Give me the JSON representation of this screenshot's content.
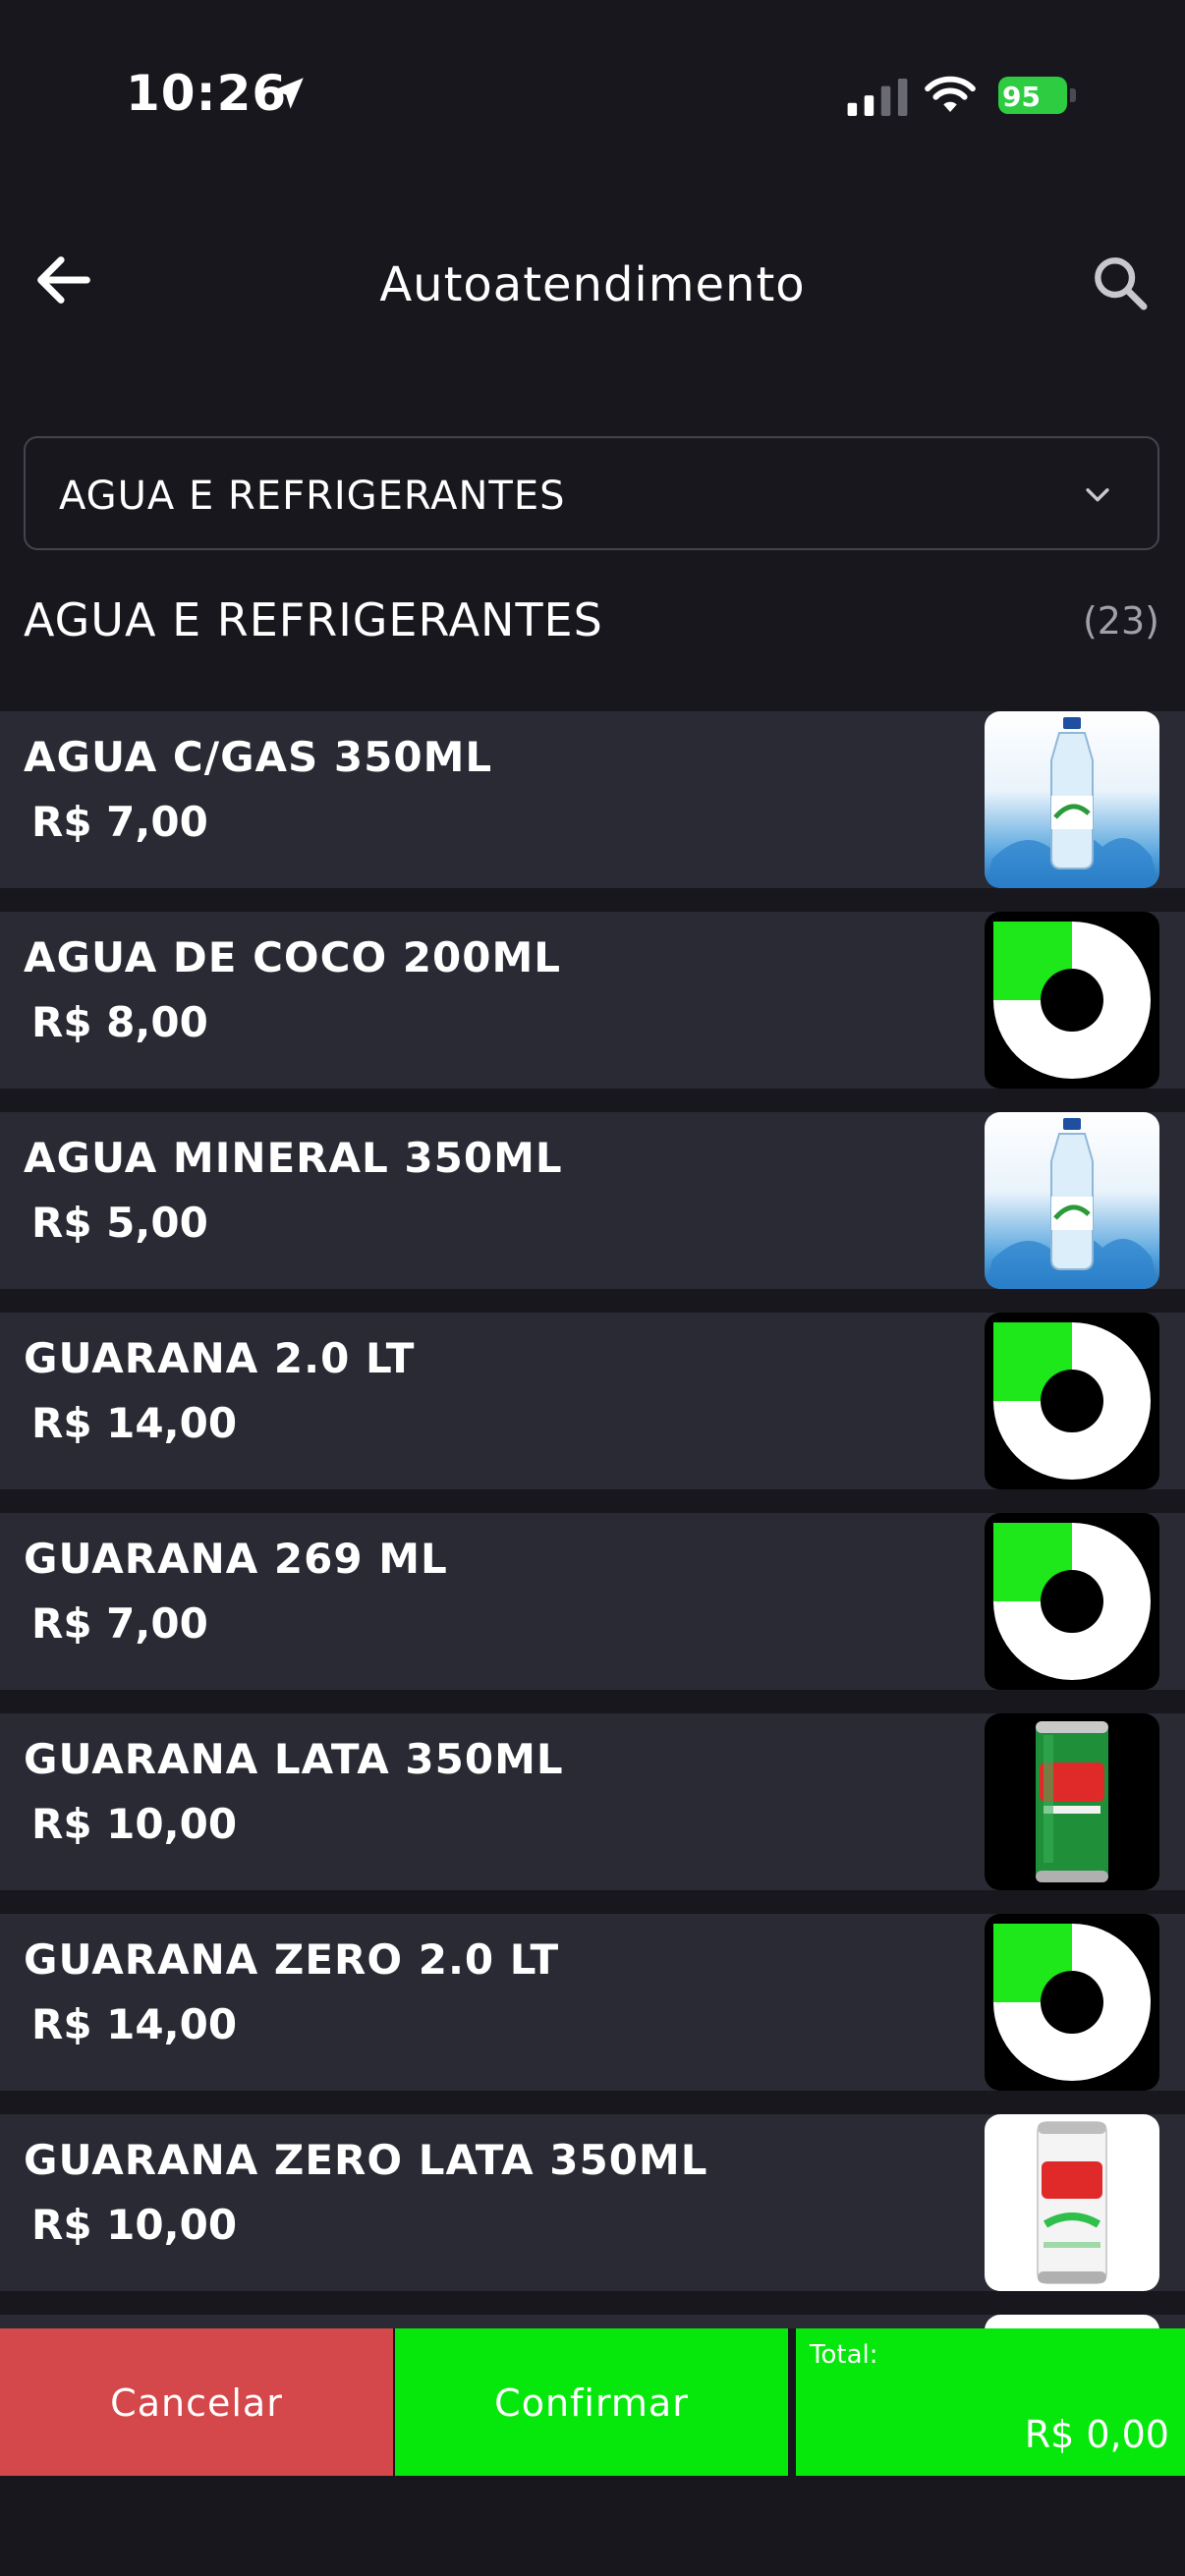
{
  "status_bar": {
    "time": "10:26",
    "battery": "95"
  },
  "header": {
    "title": "Autoatendimento"
  },
  "category_select": {
    "value": "AGUA E REFRIGERANTES"
  },
  "section": {
    "title": "AGUA E REFRIGERANTES",
    "count": "(23)"
  },
  "products": [
    {
      "name": "AGUA C/GAS 350ML",
      "price": "R$ 7,00",
      "image": "water-bottle"
    },
    {
      "name": "AGUA DE COCO 200ML",
      "price": "R$ 8,00",
      "image": "placeholder-logo"
    },
    {
      "name": "AGUA MINERAL 350ML",
      "price": "R$ 5,00",
      "image": "water-bottle"
    },
    {
      "name": "GUARANA 2.0 LT",
      "price": "R$ 14,00",
      "image": "placeholder-logo"
    },
    {
      "name": "GUARANA 269 ML",
      "price": "R$ 7,00",
      "image": "placeholder-logo"
    },
    {
      "name": "GUARANA LATA 350ML",
      "price": "R$ 10,00",
      "image": "green-can"
    },
    {
      "name": "GUARANA ZERO 2.0 LT",
      "price": "R$ 14,00",
      "image": "placeholder-logo"
    },
    {
      "name": "GUARANA ZERO LATA 350ML",
      "price": "R$ 10,00",
      "image": "white-can"
    }
  ],
  "footer": {
    "cancel_label": "Cancelar",
    "confirm_label": "Confirmar",
    "total_label": "Total:",
    "total_value": "R$ 0,00"
  },
  "colors": {
    "background": "#17171d",
    "item_background": "#292a33",
    "cancel": "#d4474b",
    "confirm": "#06e80c",
    "logo_green": "#1ee81a"
  }
}
